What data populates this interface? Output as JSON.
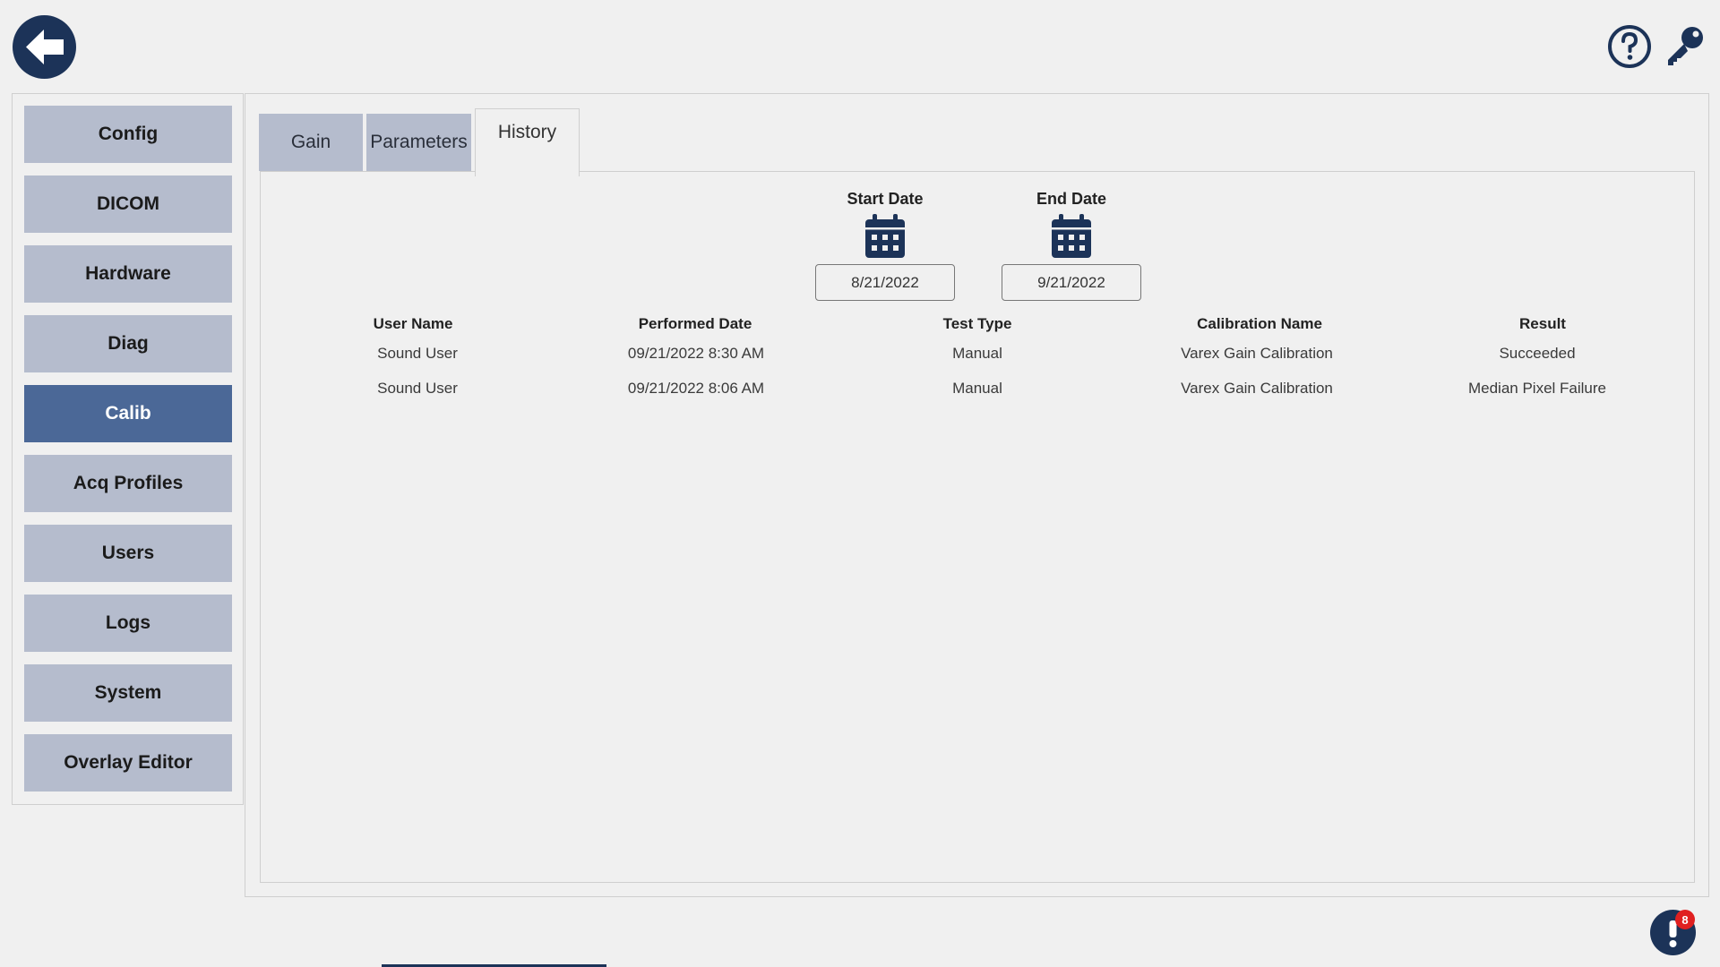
{
  "header": {
    "back_icon": "back-arrow-icon",
    "help_icon": "help-circle-icon",
    "key_icon": "key-icon"
  },
  "sidebar": {
    "items": [
      {
        "label": "Config"
      },
      {
        "label": "DICOM"
      },
      {
        "label": "Hardware"
      },
      {
        "label": "Diag"
      },
      {
        "label": "Calib",
        "active": true
      },
      {
        "label": "Acq Profiles"
      },
      {
        "label": "Users"
      },
      {
        "label": "Logs"
      },
      {
        "label": "System"
      },
      {
        "label": "Overlay Editor"
      }
    ]
  },
  "tabs": [
    {
      "label": "Gain"
    },
    {
      "label": "Parameters"
    },
    {
      "label": "History",
      "active": true
    }
  ],
  "history": {
    "start_date": {
      "label": "Start Date",
      "value": "8/21/2022",
      "icon": "calendar-icon"
    },
    "end_date": {
      "label": "End Date",
      "value": "9/21/2022",
      "icon": "calendar-icon"
    },
    "columns": [
      "User Name",
      "Performed Date",
      "Test Type",
      "Calibration Name",
      "Result"
    ],
    "rows": [
      [
        "Sound User",
        "09/21/2022 8:30 AM",
        "Manual",
        "Varex Gain Calibration",
        "Succeeded"
      ],
      [
        "Sound User",
        "09/21/2022 8:06 AM",
        "Manual",
        "Varex Gain Calibration",
        "Median Pixel Failure"
      ]
    ]
  },
  "alerts": {
    "icon": "exclamation-icon",
    "count": "8"
  },
  "colors": {
    "primary_dark": "#1c3358",
    "nav_button": "#b5bccd",
    "nav_active": "#4b6897",
    "background": "#f0f0f0",
    "badge": "#e02020"
  }
}
